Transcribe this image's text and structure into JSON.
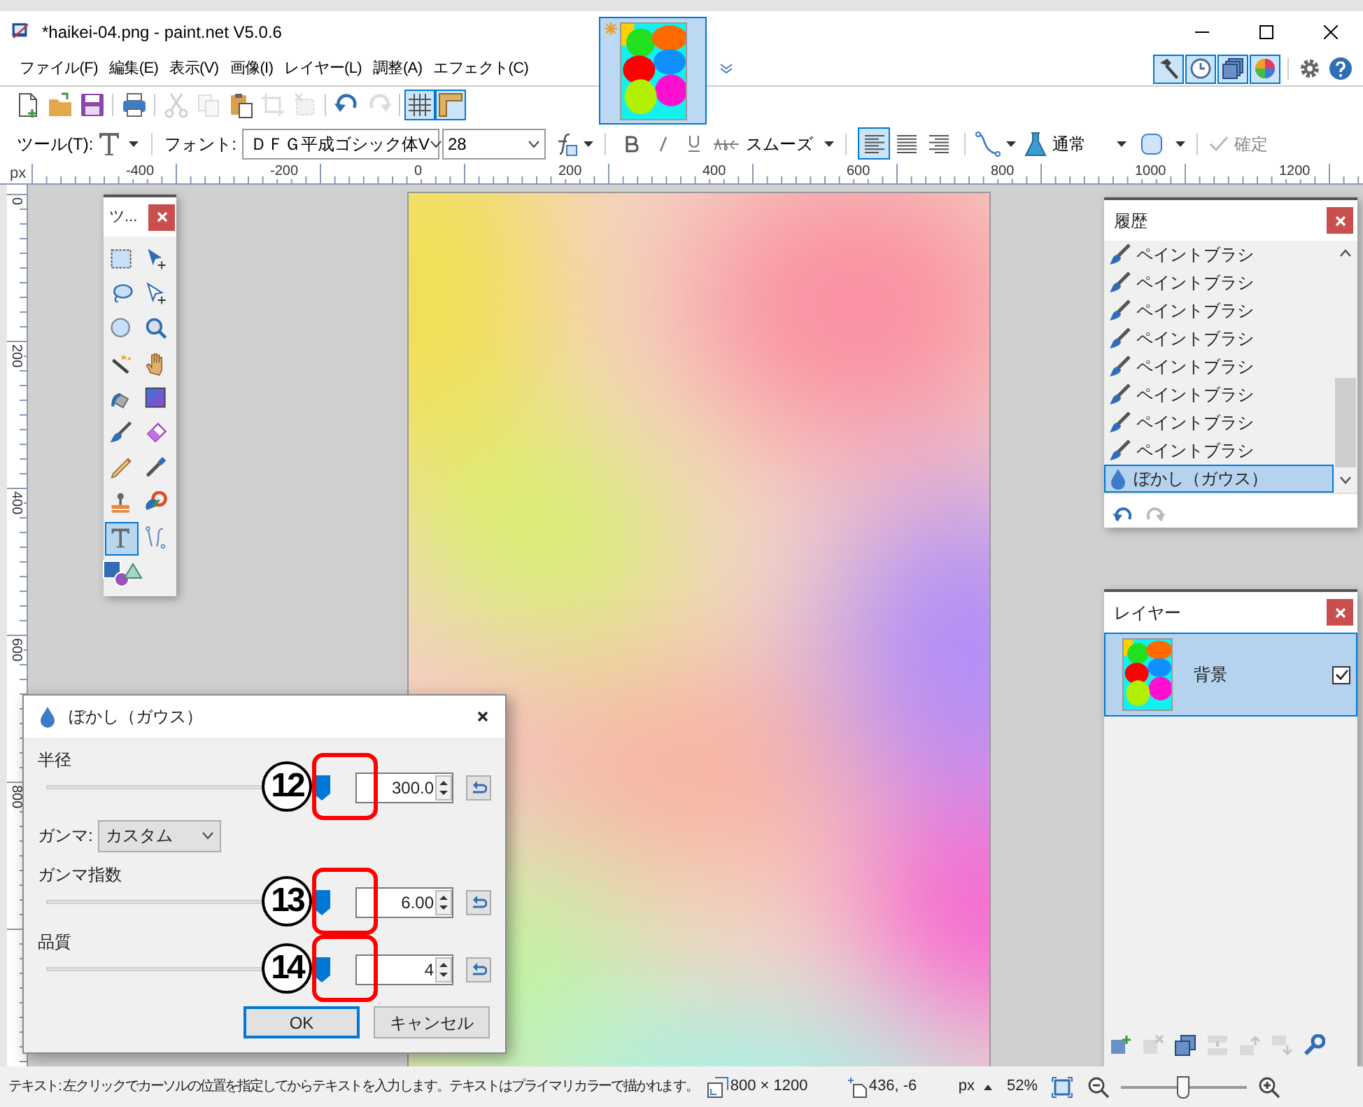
{
  "window": {
    "title": "*haikei-04.png - paint.net V5.0.6"
  },
  "image_tabs": [
    {
      "selected": true
    }
  ],
  "menu": [
    "ファイル(F)",
    "編集(E)",
    "表示(V)",
    "画像(I)",
    "レイヤー(L)",
    "調整(A)",
    "エフェクト(C)"
  ],
  "panel_toggles": [
    {
      "on": true
    },
    {
      "on": true
    },
    {
      "on": true
    },
    {
      "on": true
    }
  ],
  "toolbar": {
    "buttons": [
      {
        "disabled": false
      },
      {
        "disabled": false
      },
      {
        "disabled": false
      },
      {
        "disabled": false
      },
      {
        "disabled": true
      },
      {
        "disabled": true
      },
      {
        "disabled": false
      },
      {
        "disabled": true
      },
      {
        "disabled": true
      },
      {
        "disabled": false
      },
      {
        "disabled": true
      }
    ],
    "toggles": [
      {
        "on": true
      },
      {
        "on": true
      }
    ]
  },
  "tool_options": {
    "tool_label": "ツール(T):",
    "font_label": "フォント:",
    "font": "ＤＦＧ平成ゴシック体V",
    "size": "28",
    "smoothing": "スムーズ",
    "alignments": [
      {
        "selected": true
      },
      {
        "selected": false
      },
      {
        "selected": false
      }
    ],
    "blend_mode": "通常",
    "finish": {
      "label": "確定",
      "disabled": true
    }
  },
  "rulers": {
    "unit": "px",
    "horizontal": [
      "-400",
      "-200",
      "0",
      "200",
      "400",
      "600",
      "800",
      "1000",
      "1200"
    ],
    "vertical": [
      "0",
      "200",
      "400",
      "600",
      "800"
    ]
  },
  "tools_panel": {
    "title": "ツ...",
    "tools": [
      {
        "selected": false
      },
      {
        "selected": false
      },
      {
        "selected": false
      },
      {
        "selected": false
      },
      {
        "selected": false
      },
      {
        "selected": false
      },
      {
        "selected": false
      },
      {
        "selected": false
      },
      {
        "selected": false
      },
      {
        "selected": false
      },
      {
        "selected": false
      },
      {
        "selected": false
      },
      {
        "selected": false
      },
      {
        "selected": false
      },
      {
        "selected": false
      },
      {
        "selected": false
      },
      {
        "selected": true
      },
      {
        "selected": false
      },
      {
        "selected": false
      }
    ]
  },
  "history_panel": {
    "title": "履歴",
    "items": [
      {
        "kind": "brush",
        "label": "ペイントブラシ",
        "selected": false
      },
      {
        "kind": "brush",
        "label": "ペイントブラシ",
        "selected": false
      },
      {
        "kind": "brush",
        "label": "ペイントブラシ",
        "selected": false
      },
      {
        "kind": "brush",
        "label": "ペイントブラシ",
        "selected": false
      },
      {
        "kind": "brush",
        "label": "ペイントブラシ",
        "selected": false
      },
      {
        "kind": "brush",
        "label": "ペイントブラシ",
        "selected": false
      },
      {
        "kind": "brush",
        "label": "ペイントブラシ",
        "selected": false
      },
      {
        "kind": "brush",
        "label": "ペイントブラシ",
        "selected": false
      },
      {
        "kind": "blur",
        "label": "ぼかし（ガウス）",
        "selected": true
      }
    ],
    "actions": [
      {
        "disabled": false
      },
      {
        "disabled": true
      }
    ]
  },
  "layers_panel": {
    "title": "レイヤー",
    "layers": [
      {
        "name": "背景",
        "selected": true,
        "visible": true
      }
    ],
    "actions": [
      {
        "disabled": false
      },
      {
        "disabled": true
      },
      {
        "disabled": false
      },
      {
        "disabled": true
      },
      {
        "disabled": true
      },
      {
        "disabled": true
      },
      {
        "disabled": false
      }
    ]
  },
  "dialog": {
    "title": "ぼかし（ガウス）",
    "fields": [
      {
        "kind": "slider",
        "label": "半径",
        "level": 1,
        "value": "300.0",
        "annotation": "12"
      },
      {
        "kind": "select",
        "label": "ガンマ:",
        "value": "カスタム"
      },
      {
        "kind": "slider",
        "label": "ガンマ指数",
        "level": 1,
        "value": "6.00",
        "annotation": "13"
      },
      {
        "kind": "slider",
        "label": "品質",
        "level": 1,
        "value": "4",
        "annotation": "14"
      }
    ],
    "buttons": [
      {
        "label": "OK",
        "default": true
      },
      {
        "label": "キャンセル",
        "default": false
      }
    ]
  },
  "status_bar": {
    "hint": "テキスト: 左クリックでカーソルの位置を指定してからテキストを入力します。テキストはプライマリカラーで描かれます。",
    "image_size": "800 × 1200",
    "cursor": "436, -6",
    "units": "px",
    "zoom": "52%",
    "zoom_slider": {
      "level": 0.5
    }
  }
}
